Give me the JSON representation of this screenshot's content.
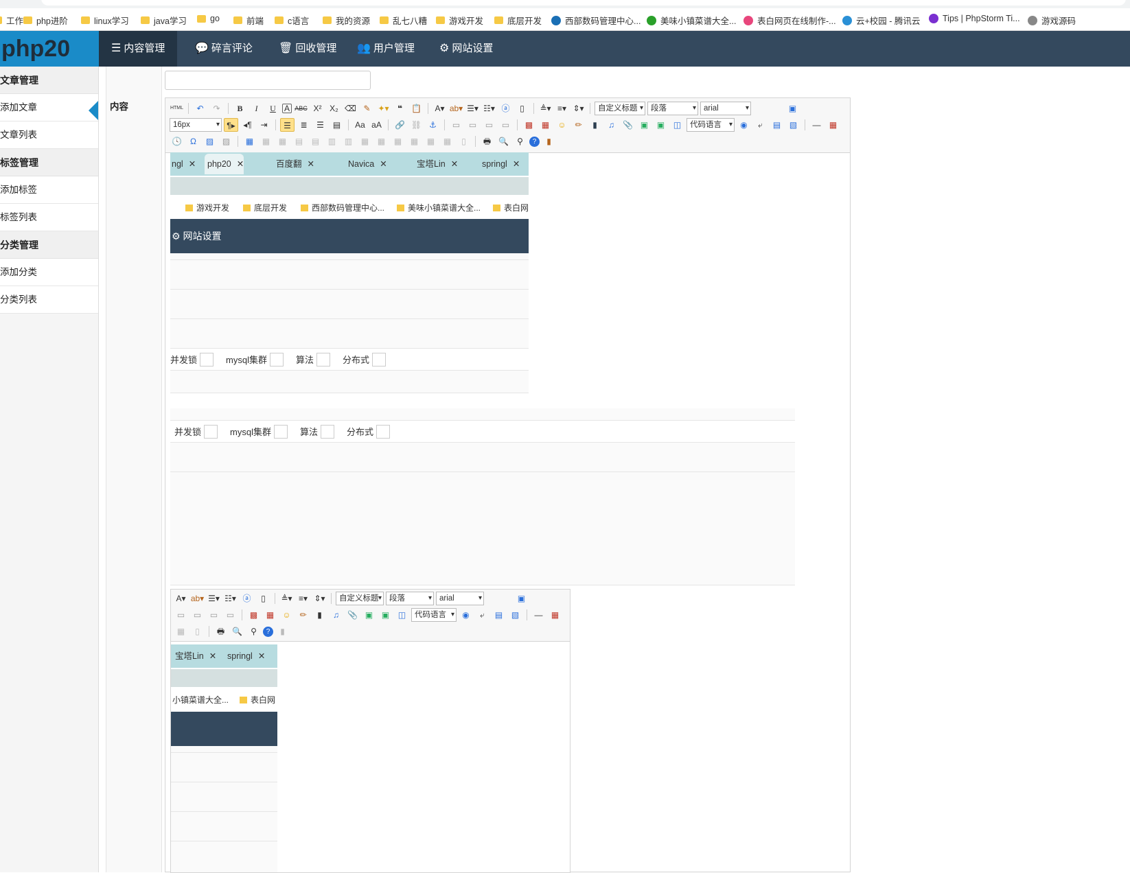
{
  "bookmarks": [
    {
      "label": "工作",
      "kind": "folder"
    },
    {
      "label": "php进阶",
      "kind": "folder"
    },
    {
      "label": "linux学习",
      "kind": "folder"
    },
    {
      "label": "java学习",
      "kind": "folder"
    },
    {
      "label": "go",
      "kind": "folder"
    },
    {
      "label": "前端",
      "kind": "folder"
    },
    {
      "label": "c语言",
      "kind": "folder"
    },
    {
      "label": "我的资源",
      "kind": "folder"
    },
    {
      "label": "乱七八糟",
      "kind": "folder"
    },
    {
      "label": "游戏开发",
      "kind": "folder"
    },
    {
      "label": "底层开发",
      "kind": "folder"
    },
    {
      "label": "西部数码管理中心...",
      "kind": "site"
    },
    {
      "label": "美味小镇菜谱大全...",
      "kind": "site"
    },
    {
      "label": "表白网页在线制作-...",
      "kind": "site"
    },
    {
      "label": "云+校园 - 腾讯云",
      "kind": "site"
    },
    {
      "label": "Tips | PhpStorm Ti...",
      "kind": "site"
    },
    {
      "label": "游戏源码",
      "kind": "site"
    }
  ],
  "app": {
    "logo": "php20",
    "nav": [
      {
        "label": "内容管理",
        "icon": "list-icon",
        "active": true
      },
      {
        "label": "碎言评论",
        "icon": "comments-icon",
        "active": false
      },
      {
        "label": "回收管理",
        "icon": "trash-icon",
        "active": false
      },
      {
        "label": "用户管理",
        "icon": "users-icon",
        "active": false
      },
      {
        "label": "网站设置",
        "icon": "gears-icon",
        "active": false
      }
    ]
  },
  "sidebar": {
    "groups": [
      {
        "title": "文章管理",
        "items": [
          "添加文章",
          "文章列表"
        ]
      },
      {
        "title": "标签管理",
        "items": [
          "添加标签",
          "标签列表"
        ]
      },
      {
        "title": "分类管理",
        "items": [
          "添加分类",
          "分类列表"
        ]
      }
    ],
    "active_item": "添加文章"
  },
  "form": {
    "content_label": "内容",
    "title_value": ""
  },
  "editor": {
    "font_size": "16px",
    "heading_select": "自定义标题",
    "paragraph_select": "段落",
    "font_family": "arial",
    "code_lang": "代码语言",
    "accent_color": "#ffe08a"
  },
  "pasted": {
    "tabs": [
      "ngl",
      "php20",
      "百度翻",
      "Navica",
      "宝塔Lin",
      "springl"
    ],
    "bookmarks": [
      "游戏开发",
      "底层开发",
      "西部数码管理中心...",
      "美味小镇菜谱大全...",
      "表白网"
    ],
    "dark_label": "网站设置",
    "checks": [
      "并发锁",
      "mysql集群",
      "算法",
      "分布式"
    ],
    "tabs_small": [
      "宝塔Lin",
      "springl"
    ],
    "bookmarks_small": [
      "小镇菜谱大全...",
      "表白网"
    ]
  }
}
